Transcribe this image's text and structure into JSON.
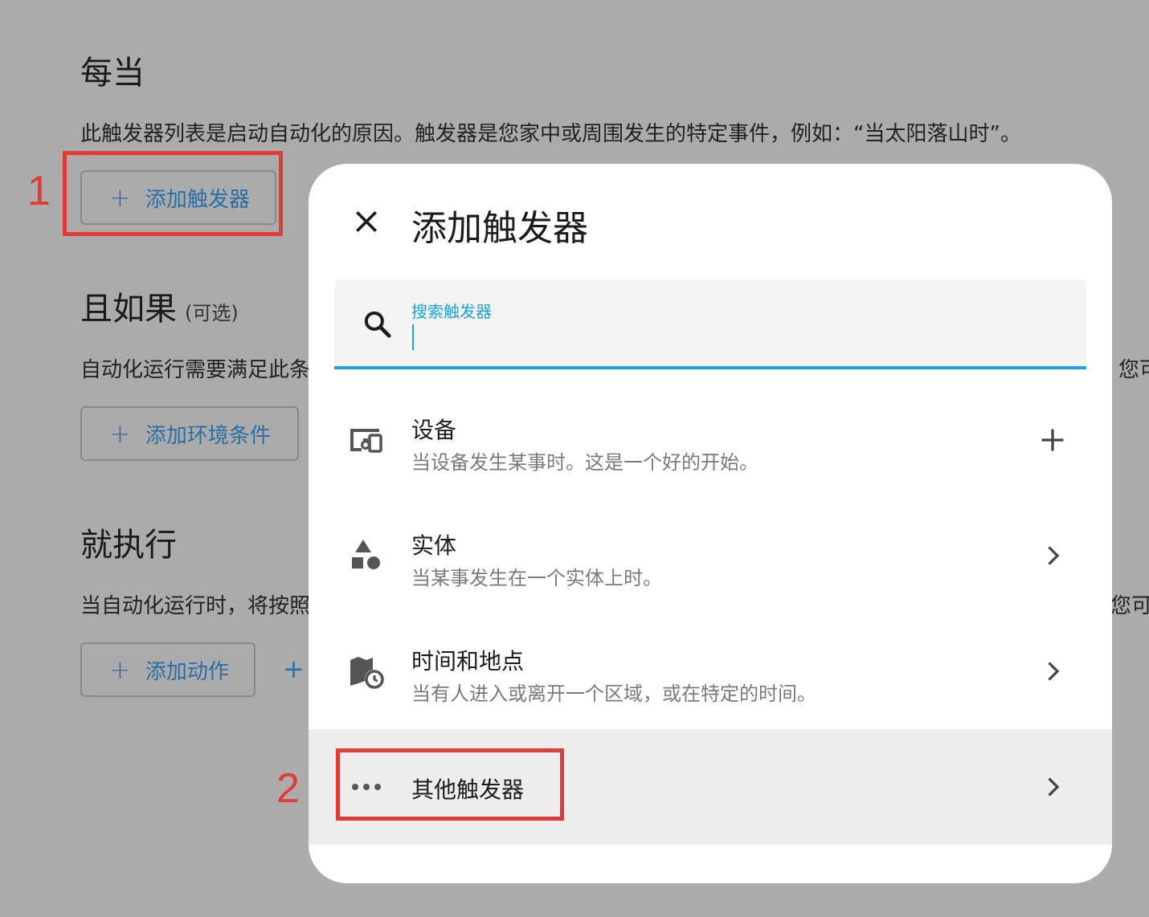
{
  "background": {
    "when": {
      "title": "每当",
      "description": "此触发器列表是启动自动化的原因。触发器是您家中或周围发生的特定事件，例如：“当太阳落山时”。",
      "add_button": "添加触发器"
    },
    "and_if": {
      "title": "且如果",
      "optional": "(可选)",
      "description": "自动化运行需要满足此条",
      "description_clip": "您可",
      "add_button": "添加环境条件"
    },
    "then_do": {
      "title": "就执行",
      "description": "当自动化运行时，将按照",
      "description_clip": "您可",
      "add_button": "添加动作",
      "extra_plus": "+"
    }
  },
  "annotations": {
    "first": "1",
    "second": "2",
    "color": "#e53935"
  },
  "dialog": {
    "title": "添加触发器",
    "search": {
      "label": "搜索触发器",
      "value": ""
    },
    "items": [
      {
        "name": "设备",
        "description": "当设备发生某事时。这是一个好的开始。",
        "icon": "devices-icon",
        "trailing": "plus-icon"
      },
      {
        "name": "实体",
        "description": "当某事发生在一个实体上时。",
        "icon": "shapes-icon",
        "trailing": "chevron-right-icon"
      },
      {
        "name": "时间和地点",
        "description": "当有人进入或离开一个区域，或在特定的时间。",
        "icon": "map-clock-icon",
        "trailing": "chevron-right-icon"
      },
      {
        "name": "其他触发器",
        "description": "",
        "icon": "dots-horizontal-icon",
        "trailing": "chevron-right-icon"
      }
    ]
  },
  "colors": {
    "accent": "#1aa3e0",
    "button_text": "#2a6ea6",
    "overlay": "#ababab"
  }
}
